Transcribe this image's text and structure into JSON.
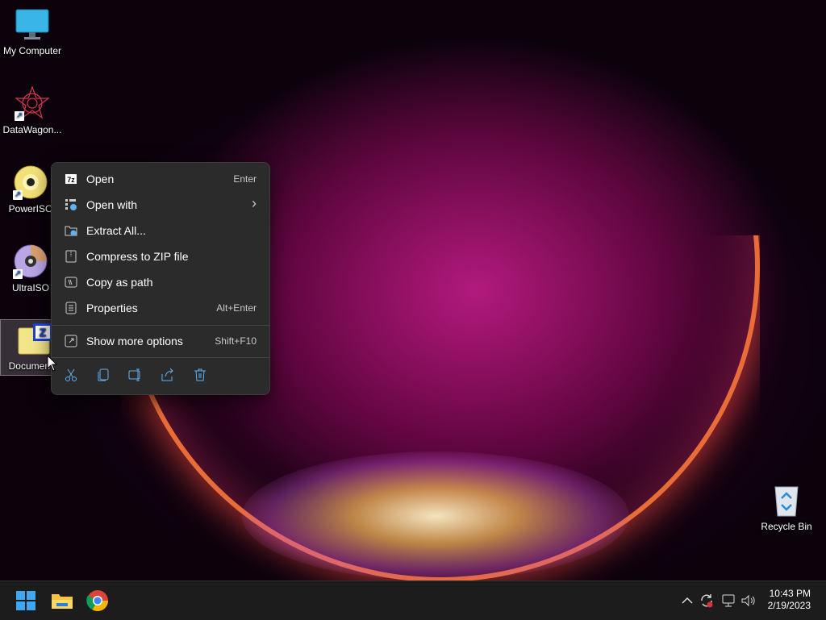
{
  "desktop": {
    "icons": [
      {
        "label": "My Computer",
        "icon": "monitor-icon"
      },
      {
        "label": "DataWagon...",
        "icon": "datawagon-icon"
      },
      {
        "label": "PowerISO",
        "icon": "poweriso-disc-icon"
      },
      {
        "label": "UltraISO",
        "icon": "ultraiso-disc-icon"
      },
      {
        "label": "Documents",
        "icon": "zip-folder-icon"
      },
      {
        "label": "Recycle Bin",
        "icon": "recycle-bin-icon"
      }
    ]
  },
  "context_menu": {
    "items": [
      {
        "label": "Open",
        "shortcut": "Enter",
        "icon": "archive-open-icon"
      },
      {
        "label": "Open with",
        "shortcut": "",
        "icon": "open-with-icon",
        "has_submenu": true
      },
      {
        "label": "Extract All...",
        "shortcut": "",
        "icon": "extract-folder-icon"
      },
      {
        "label": "Compress to ZIP file",
        "shortcut": "",
        "icon": "zip-compress-icon"
      },
      {
        "label": "Copy as path",
        "shortcut": "",
        "icon": "copy-path-icon"
      },
      {
        "label": "Properties",
        "shortcut": "Alt+Enter",
        "icon": "properties-icon"
      },
      {
        "label": "Show more options",
        "shortcut": "Shift+F10",
        "icon": "more-options-icon"
      }
    ],
    "quick_actions": [
      "cut-icon",
      "copy-icon",
      "rename-icon",
      "share-icon",
      "delete-icon"
    ],
    "submenu_glyph": "›"
  },
  "taskbar": {
    "pinned": [
      "start-icon",
      "file-explorer-icon",
      "chrome-icon"
    ],
    "tray_icons": [
      "chevron-up-icon",
      "sync-icon",
      "network-icon",
      "volume-icon"
    ],
    "time": "10:43 PM",
    "date": "2/19/2023"
  },
  "colors": {
    "menu_bg": "#2b2b2b",
    "taskbar_bg": "#1c1c1c",
    "accent": "#5fb2f2"
  }
}
